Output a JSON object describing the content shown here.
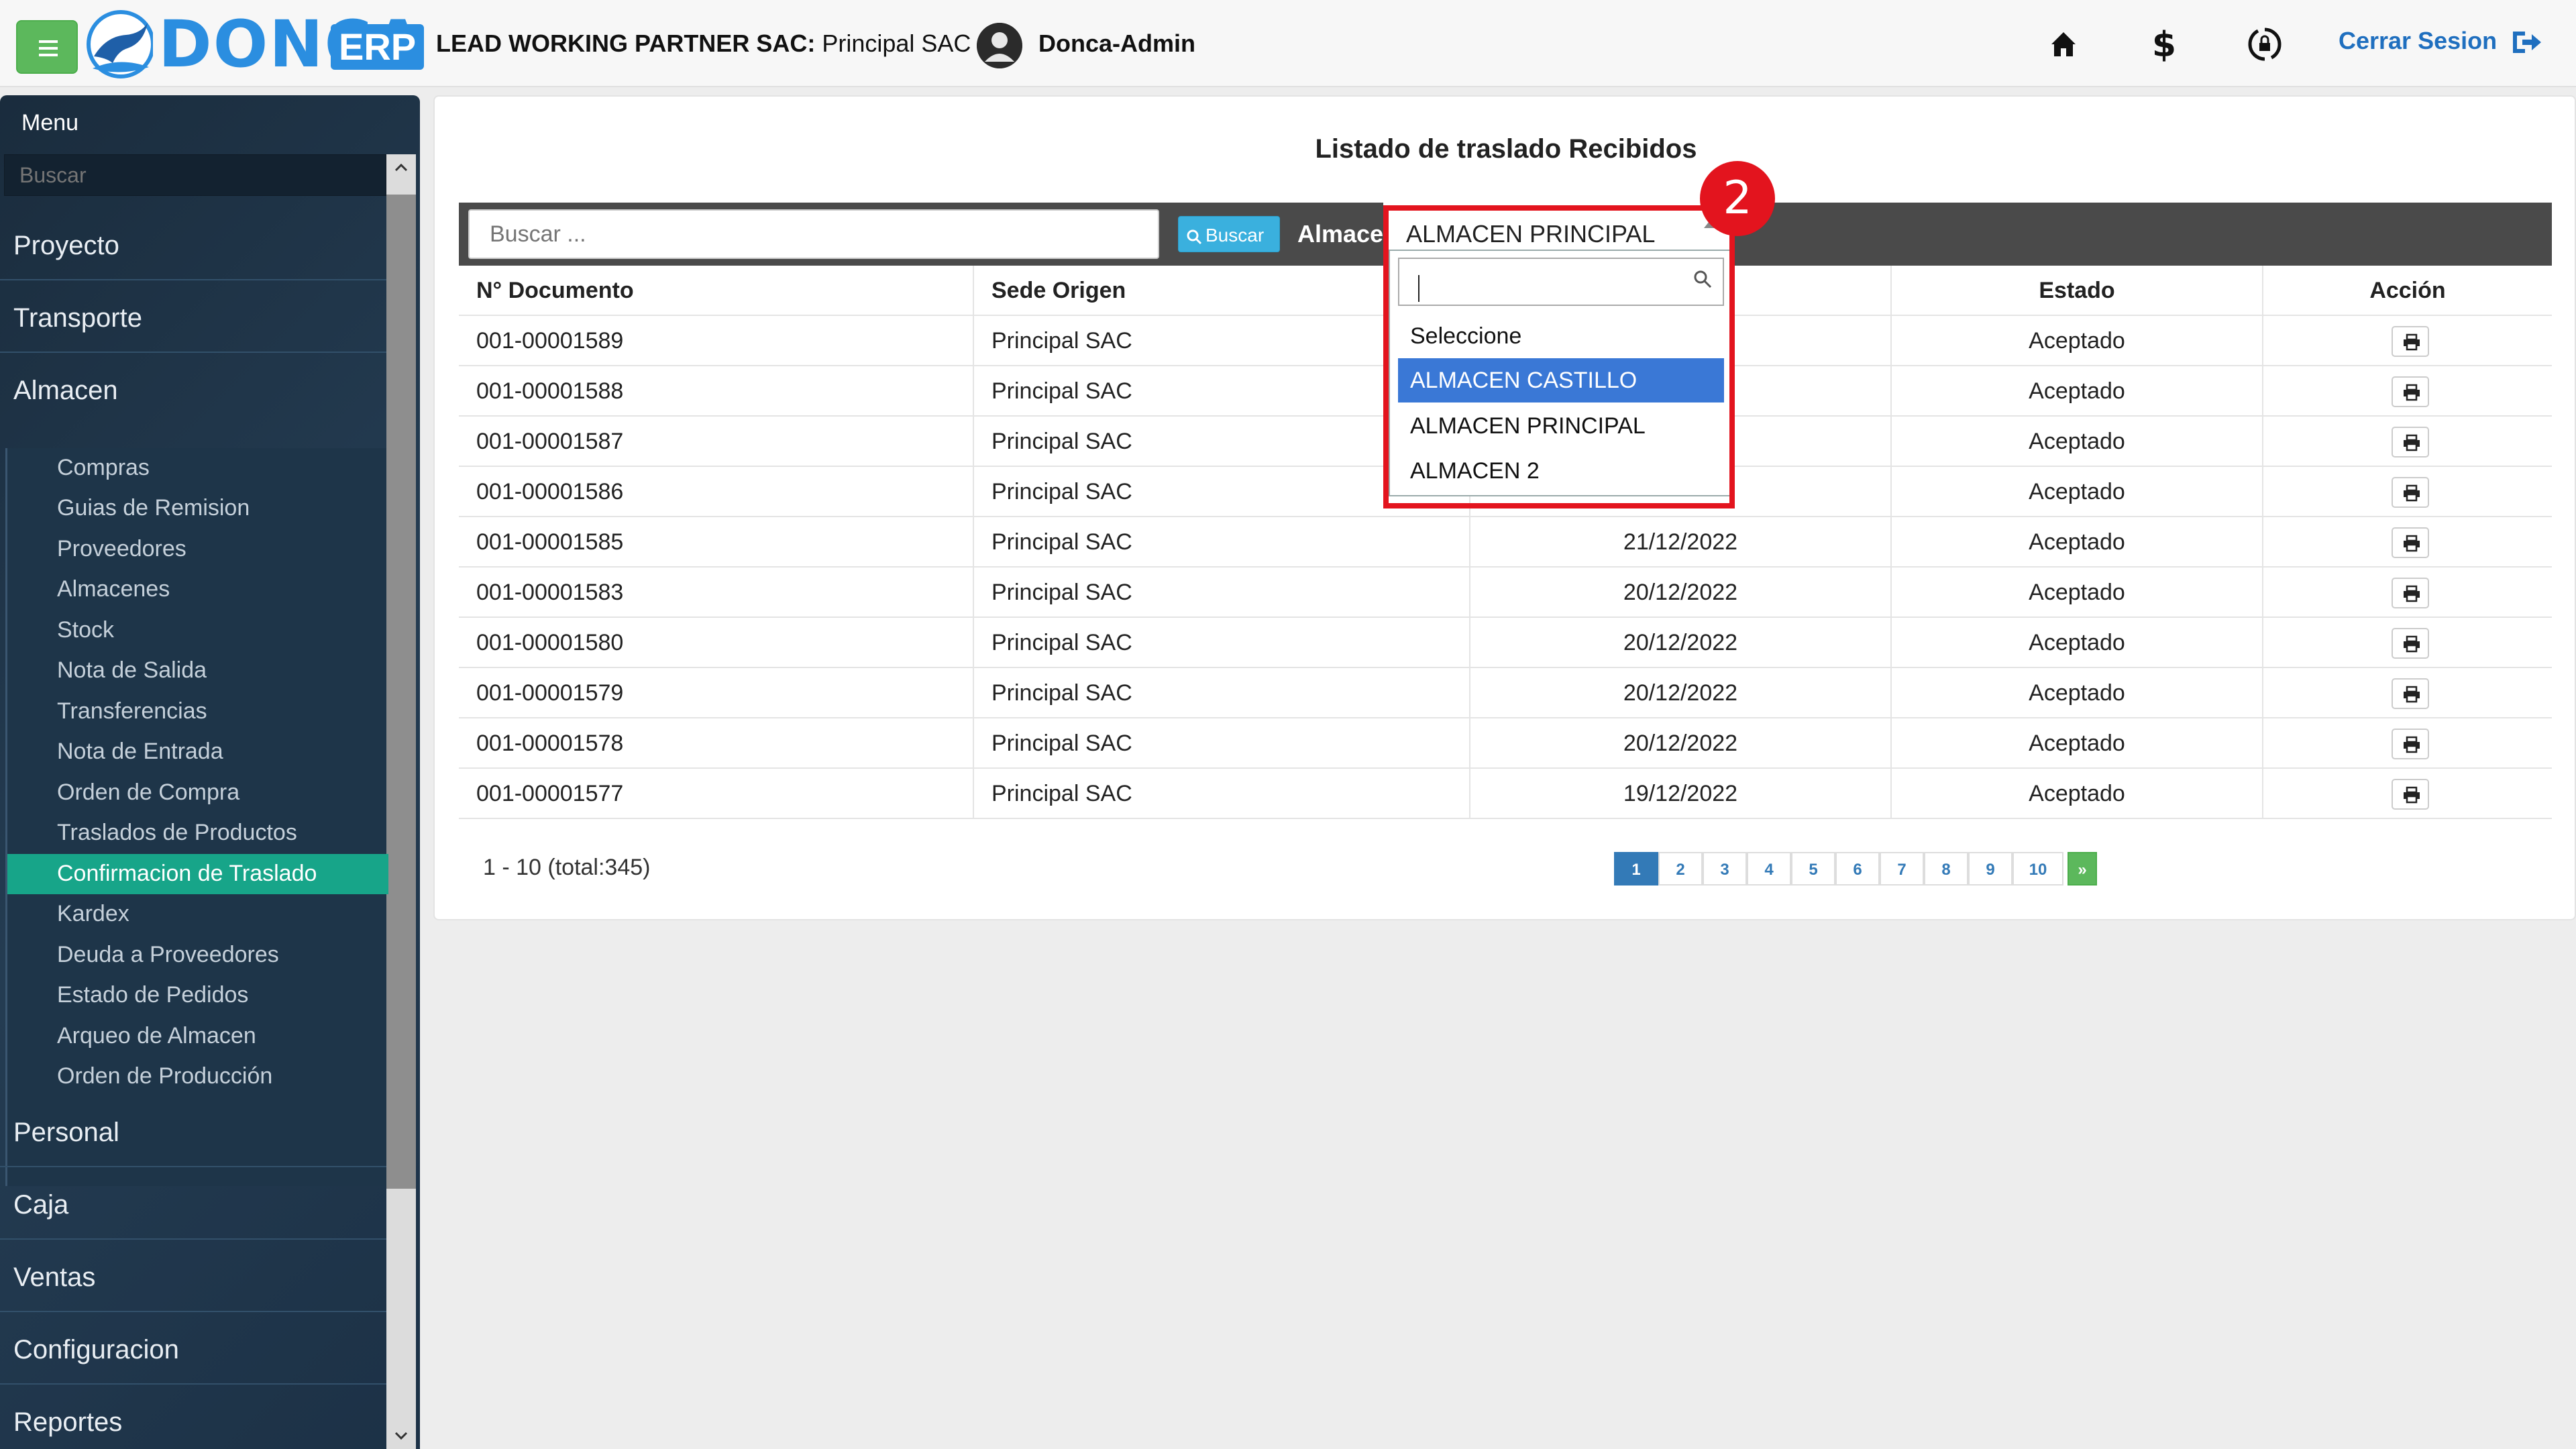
{
  "header": {
    "brand": "DONCA",
    "brand_suffix": "ERP",
    "company_bold": "LEAD WORKING PARTNER SAC:",
    "company_rest": " Principal SAC |",
    "username": "Donca-Admin",
    "logout_label": "Cerrar Sesion",
    "icons": [
      "menu-icon",
      "home-icon",
      "dollar-icon",
      "sync-lock-icon",
      "logout-icon"
    ]
  },
  "sidebar": {
    "menu_title": "Menu",
    "search_placeholder": "Buscar",
    "sections_top": [
      "Proyecto",
      "Transporte",
      "Almacen"
    ],
    "submenu": [
      "Compras",
      "Guias de Remision",
      "Proveedores",
      "Almacenes",
      "Stock",
      "Nota de Salida",
      "Transferencias",
      "Nota de Entrada",
      "Orden de Compra",
      "Traslados de Productos",
      "Confirmacion de Traslado",
      "Kardex",
      "Deuda a Proveedores",
      "Estado de Pedidos",
      "Arqueo de Almacen",
      "Orden de Producción"
    ],
    "active_submenu": "Confirmacion de Traslado",
    "sections_bottom": [
      "Personal",
      "Caja",
      "Ventas",
      "Configuracion",
      "Reportes"
    ]
  },
  "main": {
    "title": "Listado de traslado Recibidos",
    "search_placeholder": "Buscar ...",
    "search_button": "Buscar",
    "almacen_label": "Almacen:",
    "almacen_selected": "ALMACEN PRINCIPAL",
    "dropdown": {
      "options": [
        "Seleccione",
        "ALMACEN CASTILLO",
        "ALMACEN PRINCIPAL",
        "ALMACEN 2"
      ],
      "highlighted": "ALMACEN CASTILLO"
    },
    "step_badge": "2",
    "table": {
      "headers": [
        "N° Documento",
        "Sede Origen",
        "",
        "Estado",
        "Acción"
      ],
      "rows": [
        {
          "doc": "001-00001589",
          "sede": "Principal SAC",
          "fecha": "",
          "estado": "Aceptado"
        },
        {
          "doc": "001-00001588",
          "sede": "Principal SAC",
          "fecha": "",
          "estado": "Aceptado"
        },
        {
          "doc": "001-00001587",
          "sede": "Principal SAC",
          "fecha": "",
          "estado": "Aceptado"
        },
        {
          "doc": "001-00001586",
          "sede": "Principal SAC",
          "fecha": "",
          "estado": "Aceptado"
        },
        {
          "doc": "001-00001585",
          "sede": "Principal SAC",
          "fecha": "21/12/2022",
          "estado": "Aceptado"
        },
        {
          "doc": "001-00001583",
          "sede": "Principal SAC",
          "fecha": "20/12/2022",
          "estado": "Aceptado"
        },
        {
          "doc": "001-00001580",
          "sede": "Principal SAC",
          "fecha": "20/12/2022",
          "estado": "Aceptado"
        },
        {
          "doc": "001-00001579",
          "sede": "Principal SAC",
          "fecha": "20/12/2022",
          "estado": "Aceptado"
        },
        {
          "doc": "001-00001578",
          "sede": "Principal SAC",
          "fecha": "20/12/2022",
          "estado": "Aceptado"
        },
        {
          "doc": "001-00001577",
          "sede": "Principal SAC",
          "fecha": "19/12/2022",
          "estado": "Aceptado"
        }
      ]
    },
    "pagination": {
      "summary": "1 - 10 (total:345)",
      "pages": [
        "1",
        "2",
        "3",
        "4",
        "5",
        "6",
        "7",
        "8",
        "9",
        "10"
      ],
      "active_page": "1",
      "next_label": "»"
    }
  },
  "colors": {
    "accent_green": "#5cb85c",
    "brand_blue": "#2b8ee0",
    "sidebar_active": "#17a589",
    "highlight_red": "#e3141e",
    "option_highlight": "#3a78d6"
  }
}
